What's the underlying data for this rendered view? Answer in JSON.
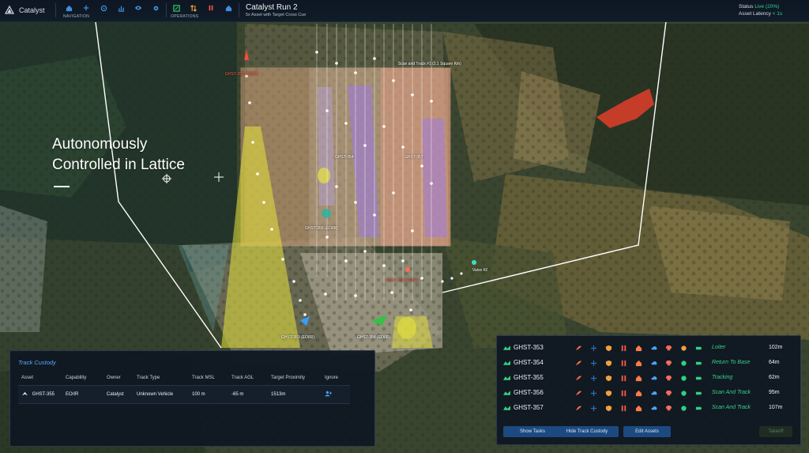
{
  "app": {
    "name": "Catalyst"
  },
  "nav": {
    "navigation_label": "NAVIGATION",
    "operations_label": "OPERATIONS",
    "icons": [
      "home-icon",
      "plus-icon",
      "target-icon",
      "chart-icon",
      "eye-icon",
      "gear-icon"
    ],
    "ops_icons": [
      "map-icon",
      "sort-icon",
      "pause-icon",
      "home-icon"
    ]
  },
  "run": {
    "title": "Catalyst Run 2",
    "subtitle": "5x Asset with Target Cross Cue"
  },
  "status": {
    "label": "Status",
    "value": "Live (20%)",
    "latency_label": "Asset Latency",
    "latency_value": "< 1s"
  },
  "headline": {
    "line1": "Autonomously",
    "line2": "Controlled in Lattice"
  },
  "map_labels": {
    "scan_track": "Scan and Track #1 (2.1 Square Km)",
    "ghst354": "GHST-354",
    "ghst357": "GHST-357",
    "alert1": "GHST-353 (EO/IR)",
    "alert2": "GHST-355 (EO/IR)",
    "ghst356": "GHST-356 (EO/IR)",
    "tracked": "GHST-355 (EO/IR)",
    "valve": "Valve #2",
    "ghst353": "GHST-353 (EO/IR)",
    "ghst354b": "GHST-354 (EO/IR)"
  },
  "custody": {
    "title": "Track Custody",
    "columns": [
      "Asset",
      "Capability",
      "Owner",
      "Track Type",
      "Track MSL",
      "Track AGL",
      "Target Proximity",
      "Ignore"
    ],
    "row": {
      "asset": "GHST-355",
      "capability": "EO/IR",
      "owner": "Catalyst",
      "track_type": "Unknown Vehicle",
      "msl": "100 m",
      "agl": "-65 m",
      "proximity": "1513m"
    }
  },
  "assets": [
    {
      "name": "GHST-353",
      "state": "Loiter",
      "dist": "102m",
      "status_color": "#f0a03c"
    },
    {
      "name": "GHST-354",
      "state": "Return To Base",
      "dist": "64m",
      "status_color": "#2fd17f"
    },
    {
      "name": "GHST-355",
      "state": "Tracking",
      "dist": "62m",
      "status_color": "#2fd17f"
    },
    {
      "name": "GHST-356",
      "state": "Scan And Track",
      "dist": "95m",
      "status_color": "#2fd17f"
    },
    {
      "name": "GHST-357",
      "state": "Scan And Track",
      "dist": "107m",
      "status_color": "#2fd17f"
    }
  ],
  "asset_buttons": {
    "show_tasks": "Show Tasks",
    "hide_custody": "Hide Track Custody",
    "edit_assets": "Edit Assets",
    "takeoff": "Takeoff"
  },
  "colors": {
    "accent": "#3d8fe0",
    "live": "#36d18a",
    "alert": "#ff5a4a",
    "button": "#1c4a80"
  }
}
